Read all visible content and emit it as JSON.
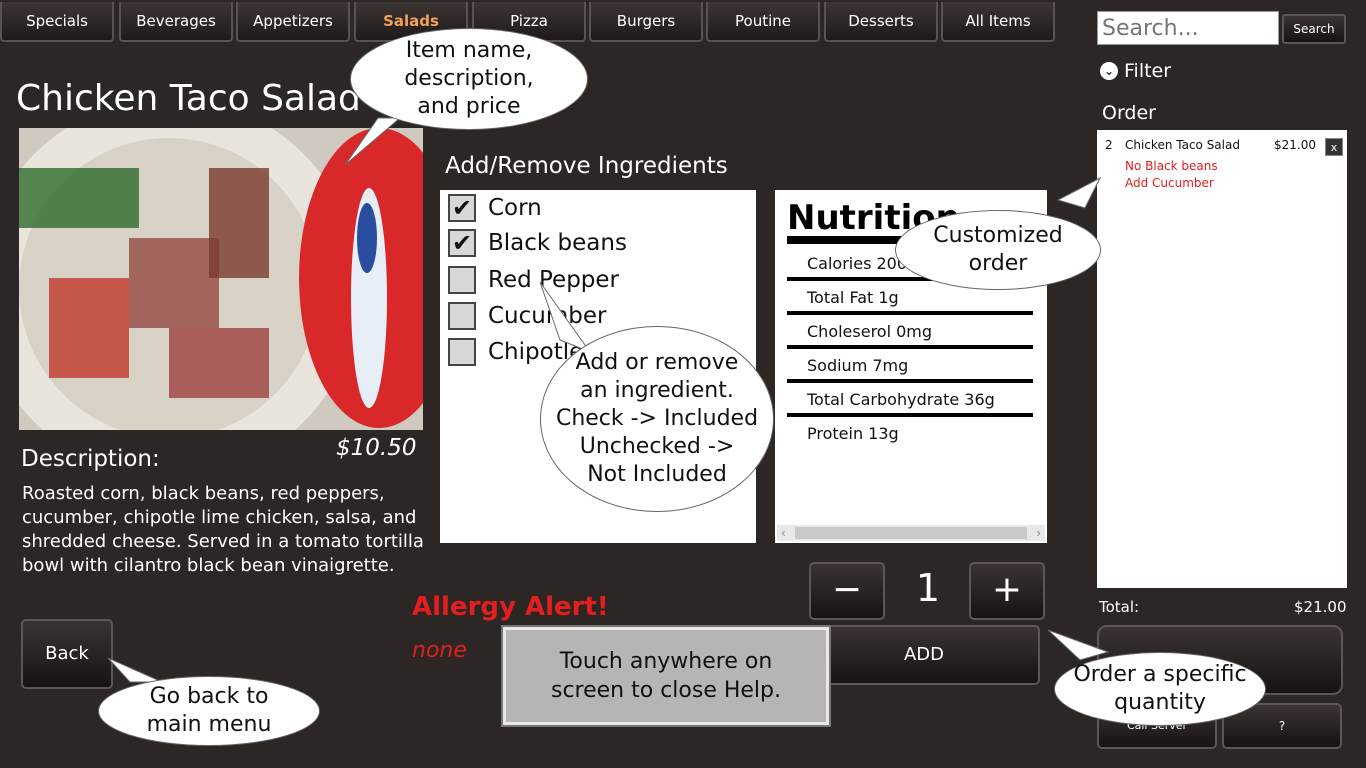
{
  "tabs": [
    "Specials",
    "Beverages",
    "Appetizers",
    "Salads",
    "Pizza",
    "Burgers",
    "Poutine",
    "Desserts",
    "All Items"
  ],
  "active_tab": "Salads",
  "item": {
    "name": "Chicken Taco Salad",
    "description_label": "Description:",
    "price": "$10.50",
    "description": "Roasted corn, black beans, red peppers, cucumber, chipotle lime chicken, salsa, and shredded cheese. Served in a tomato tortilla bowl with cilantro black bean vinaigrette."
  },
  "back_label": "Back",
  "ingredients": {
    "title": "Add/Remove Ingredients",
    "items": [
      {
        "label": "Corn",
        "checked": true
      },
      {
        "label": "Black beans",
        "checked": true
      },
      {
        "label": "Red Pepper",
        "checked": false
      },
      {
        "label": "Cucumber",
        "checked": false
      },
      {
        "label": "Chipotle",
        "checked": false
      }
    ]
  },
  "nutrition": {
    "title": "Nutrition",
    "rows": [
      "Calories 200",
      "Total Fat 1g",
      "Choleserol 0mg",
      "Sodium 7mg",
      "Total Carbohydrate 36g",
      "Protein 13g"
    ]
  },
  "quantity": {
    "minus": "−",
    "value": "1",
    "plus": "+"
  },
  "add_label": "ADD",
  "allergy": {
    "title": "Allergy Alert!",
    "value": "none"
  },
  "search": {
    "placeholder": "Search...",
    "button": "Search"
  },
  "filter_label": "Filter",
  "order": {
    "label": "Order",
    "items": [
      {
        "qty": "2",
        "name": "Chicken Taco Salad",
        "price": "$21.00",
        "remove": "x",
        "mods": [
          "No Black beans",
          "Add Cucumber"
        ]
      }
    ],
    "total_label": "Total:",
    "total": "$21.00"
  },
  "footer": {
    "call_server": "Call Server",
    "help": "?"
  },
  "help": {
    "item_bubble": "Item name, description, and price",
    "ingredient_bubble_1": "Add or remove an ingredient.",
    "ingredient_bubble_2": "Check -> Included",
    "ingredient_bubble_3": "Unchecked -> Not Included",
    "order_bubble": "Customized order",
    "back_bubble": "Go back to main menu",
    "quantity_bubble": "Order a specific quantity",
    "close": "Touch anywhere on screen to close Help."
  },
  "colors": {
    "background": "#2c2624",
    "active_tab": "#f2a05a",
    "alert": "#e31e1e"
  }
}
